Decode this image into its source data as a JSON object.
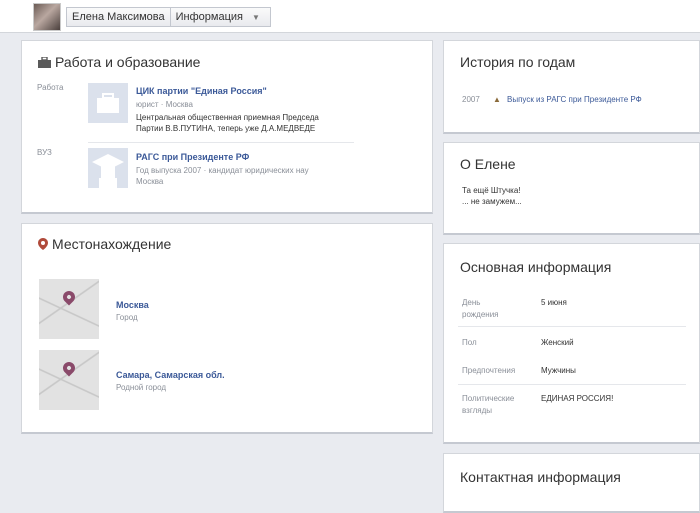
{
  "header": {
    "user_name": "Елена Максимова",
    "section": "Информация"
  },
  "work_education": {
    "title": "Работа и образование",
    "work": {
      "label": "Работа",
      "employer": "ЦИК партии \"Единая Россия\"",
      "position": "юрист · Москва",
      "desc_line1": "Центральная общественная приемная Председа",
      "desc_line2": "Партии В.В.ПУТИНА, теперь уже Д.А.МЕДВЕДЕ"
    },
    "school": {
      "label": "ВУЗ",
      "name": "РАГС при Президенте РФ",
      "detail_line1": "Год выпуска 2007 · кандидат юридических нау",
      "detail_line2": "Москва"
    }
  },
  "location": {
    "title": "Местонахождение",
    "places": [
      {
        "name": "Москва",
        "type": "Город"
      },
      {
        "name": "Самара, Самарская обл.",
        "type": "Родной город"
      }
    ]
  },
  "history": {
    "title": "История по годам",
    "year": "2007",
    "event": "Выпуск из РАГС при Президенте РФ"
  },
  "about": {
    "title": "О Елене",
    "line1": "Та ещё Штучка!",
    "line2": "... не замужем..."
  },
  "basic_info": {
    "title": "Основная информация",
    "rows": [
      {
        "label1": "День",
        "label2": "рождения",
        "value": "5 июня"
      },
      {
        "label1": "Пол",
        "label2": "",
        "value": "Женский"
      },
      {
        "label1": "Предпочтения",
        "label2": "",
        "value": "Мужчины"
      },
      {
        "label1": "Политические",
        "label2": "взгляды",
        "value": "ЕДИНАЯ РОССИЯ!"
      }
    ]
  },
  "contact": {
    "title": "Контактная информация"
  },
  "colors": {
    "link": "#3b5998",
    "background": "#e9ebf0",
    "icon_placeholder": "#dbe1ec",
    "pin": "#8a4a6a"
  }
}
